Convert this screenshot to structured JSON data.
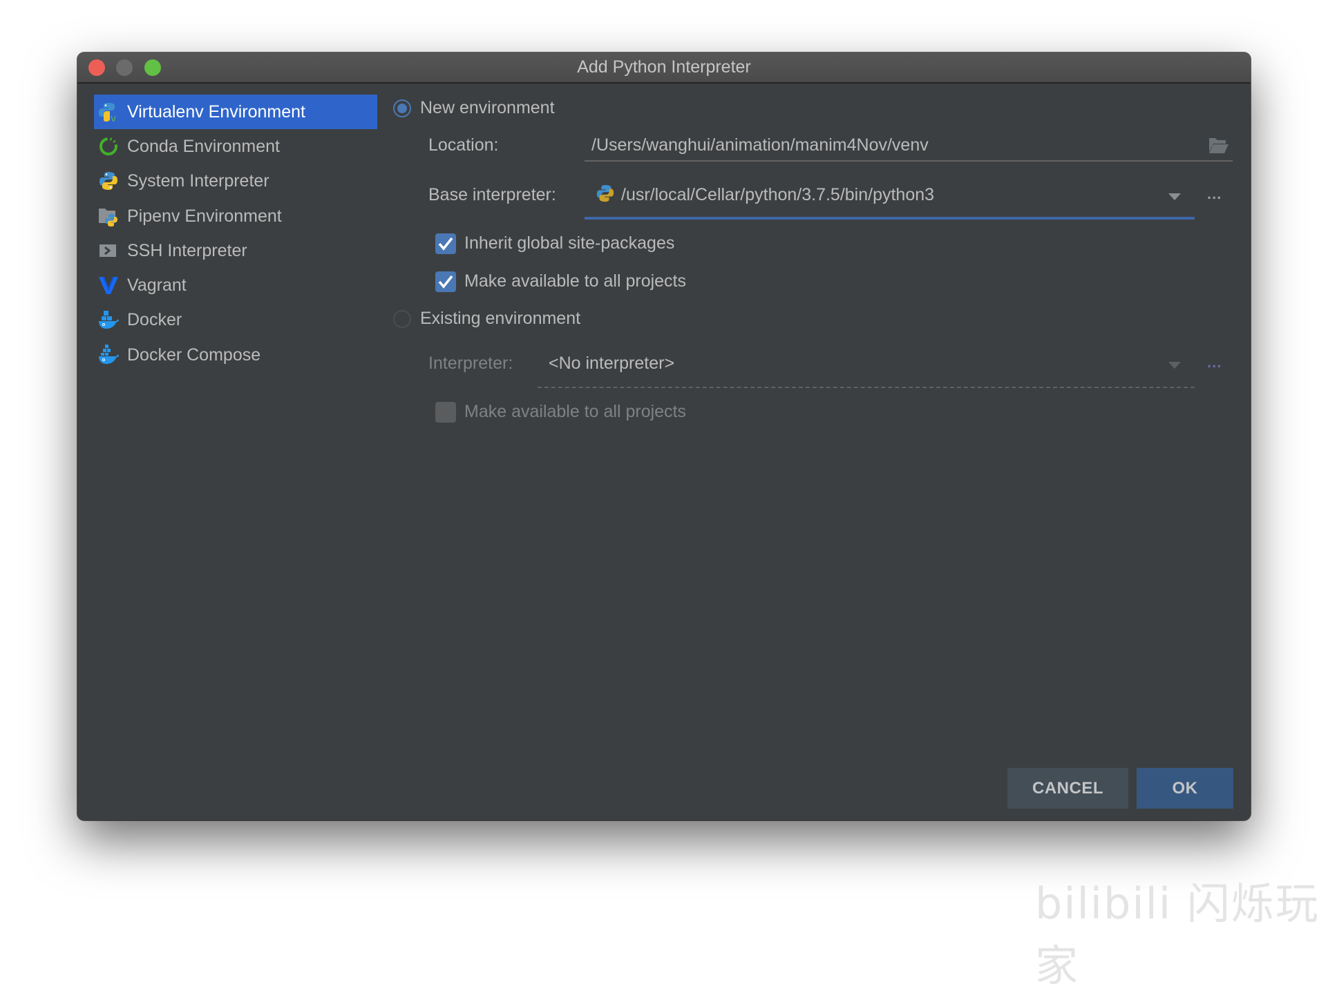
{
  "window": {
    "title": "Add Python Interpreter",
    "controls": [
      "close",
      "minimize",
      "maximize"
    ]
  },
  "sidebar": {
    "items": [
      {
        "label": "Virtualenv Environment",
        "icon": "virtualenv-icon",
        "selected": true
      },
      {
        "label": "Conda Environment",
        "icon": "conda-icon",
        "selected": false
      },
      {
        "label": "System Interpreter",
        "icon": "python-icon",
        "selected": false
      },
      {
        "label": "Pipenv Environment",
        "icon": "pipenv-icon",
        "selected": false
      },
      {
        "label": "SSH Interpreter",
        "icon": "ssh-icon",
        "selected": false
      },
      {
        "label": "Vagrant",
        "icon": "vagrant-icon",
        "selected": false
      },
      {
        "label": "Docker",
        "icon": "docker-icon",
        "selected": false
      },
      {
        "label": "Docker Compose",
        "icon": "docker-compose-icon",
        "selected": false
      }
    ]
  },
  "new_env": {
    "radio_label": "New environment",
    "selected": true,
    "location_label": "Location:",
    "location_value": "/Users/wanghui/animation/manim4Nov/venv",
    "base_label": "Base interpreter:",
    "base_value": "/usr/local/Cellar/python/3.7.5/bin/python3",
    "inherit_label": "Inherit global site-packages",
    "inherit_checked": true,
    "make_available_label": "Make available to all projects",
    "make_available_checked": true,
    "more_label": "..."
  },
  "existing_env": {
    "radio_label": "Existing environment",
    "selected": false,
    "interpreter_label": "Interpreter:",
    "interpreter_value": "<No interpreter>",
    "make_available_label": "Make available to all projects",
    "make_available_checked": false,
    "more_label": "..."
  },
  "buttons": {
    "cancel": "CANCEL",
    "ok": "OK"
  },
  "watermark": "bilibili 闪烁玩家",
  "colors": {
    "dialog_bg": "#3c3f41",
    "selection": "#2f65ca",
    "accent": "#4a78b4",
    "ok_button": "#365880",
    "cancel_button": "#434e57"
  }
}
